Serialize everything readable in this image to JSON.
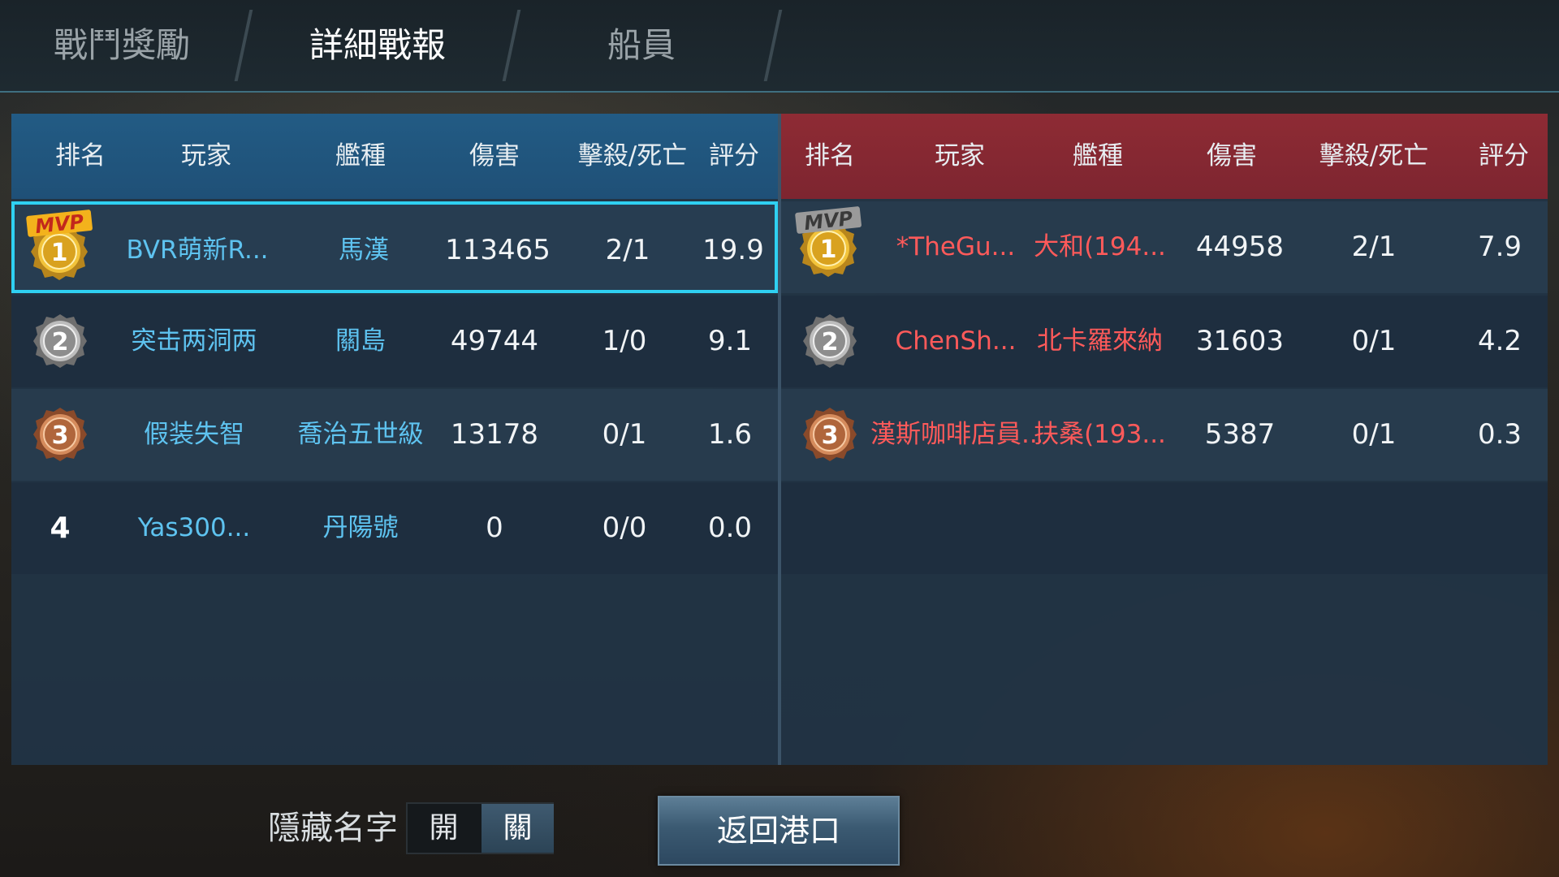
{
  "tabs": [
    {
      "label": "戰鬥獎勵",
      "active": false
    },
    {
      "label": "詳細戰報",
      "active": true
    },
    {
      "label": "船員",
      "active": false
    }
  ],
  "columns": [
    "排名",
    "玩家",
    "艦種",
    "傷害",
    "擊殺/死亡",
    "評分"
  ],
  "team_ally": {
    "color": "#225b84",
    "rows": [
      {
        "rank": "1",
        "mvp": true,
        "player": "BVR萌新R...",
        "ship": "馬漢",
        "damage": "113465",
        "kd": "2/1",
        "score": "19.9"
      },
      {
        "rank": "2",
        "mvp": false,
        "player": "突击两洞两",
        "ship": "關島",
        "damage": "49744",
        "kd": "1/0",
        "score": "9.1"
      },
      {
        "rank": "3",
        "mvp": false,
        "player": "假装失智",
        "ship": "喬治五世級",
        "damage": "13178",
        "kd": "0/1",
        "score": "1.6"
      },
      {
        "rank": "4",
        "mvp": false,
        "player": "Yas300...",
        "ship": "丹陽號",
        "damage": "0",
        "kd": "0/0",
        "score": "0.0"
      }
    ]
  },
  "team_enemy": {
    "color": "#8e2b34",
    "rows": [
      {
        "rank": "1",
        "mvp": true,
        "player": "*TheGu...",
        "ship": "大和(194...",
        "damage": "44958",
        "kd": "2/1",
        "score": "7.9"
      },
      {
        "rank": "2",
        "mvp": false,
        "player": "ChenSh...",
        "ship": "北卡羅來納",
        "damage": "31603",
        "kd": "0/1",
        "score": "4.2"
      },
      {
        "rank": "3",
        "mvp": false,
        "player": "漢斯咖啡店員...",
        "ship": "扶桑(193...",
        "damage": "5387",
        "kd": "0/1",
        "score": "0.3"
      }
    ]
  },
  "mvp_label": "MVP",
  "bottom": {
    "hide_names_label": "隱藏名字",
    "toggle_on": "開",
    "toggle_off": "關",
    "toggle_state": "off",
    "return_button": "返回港口"
  }
}
